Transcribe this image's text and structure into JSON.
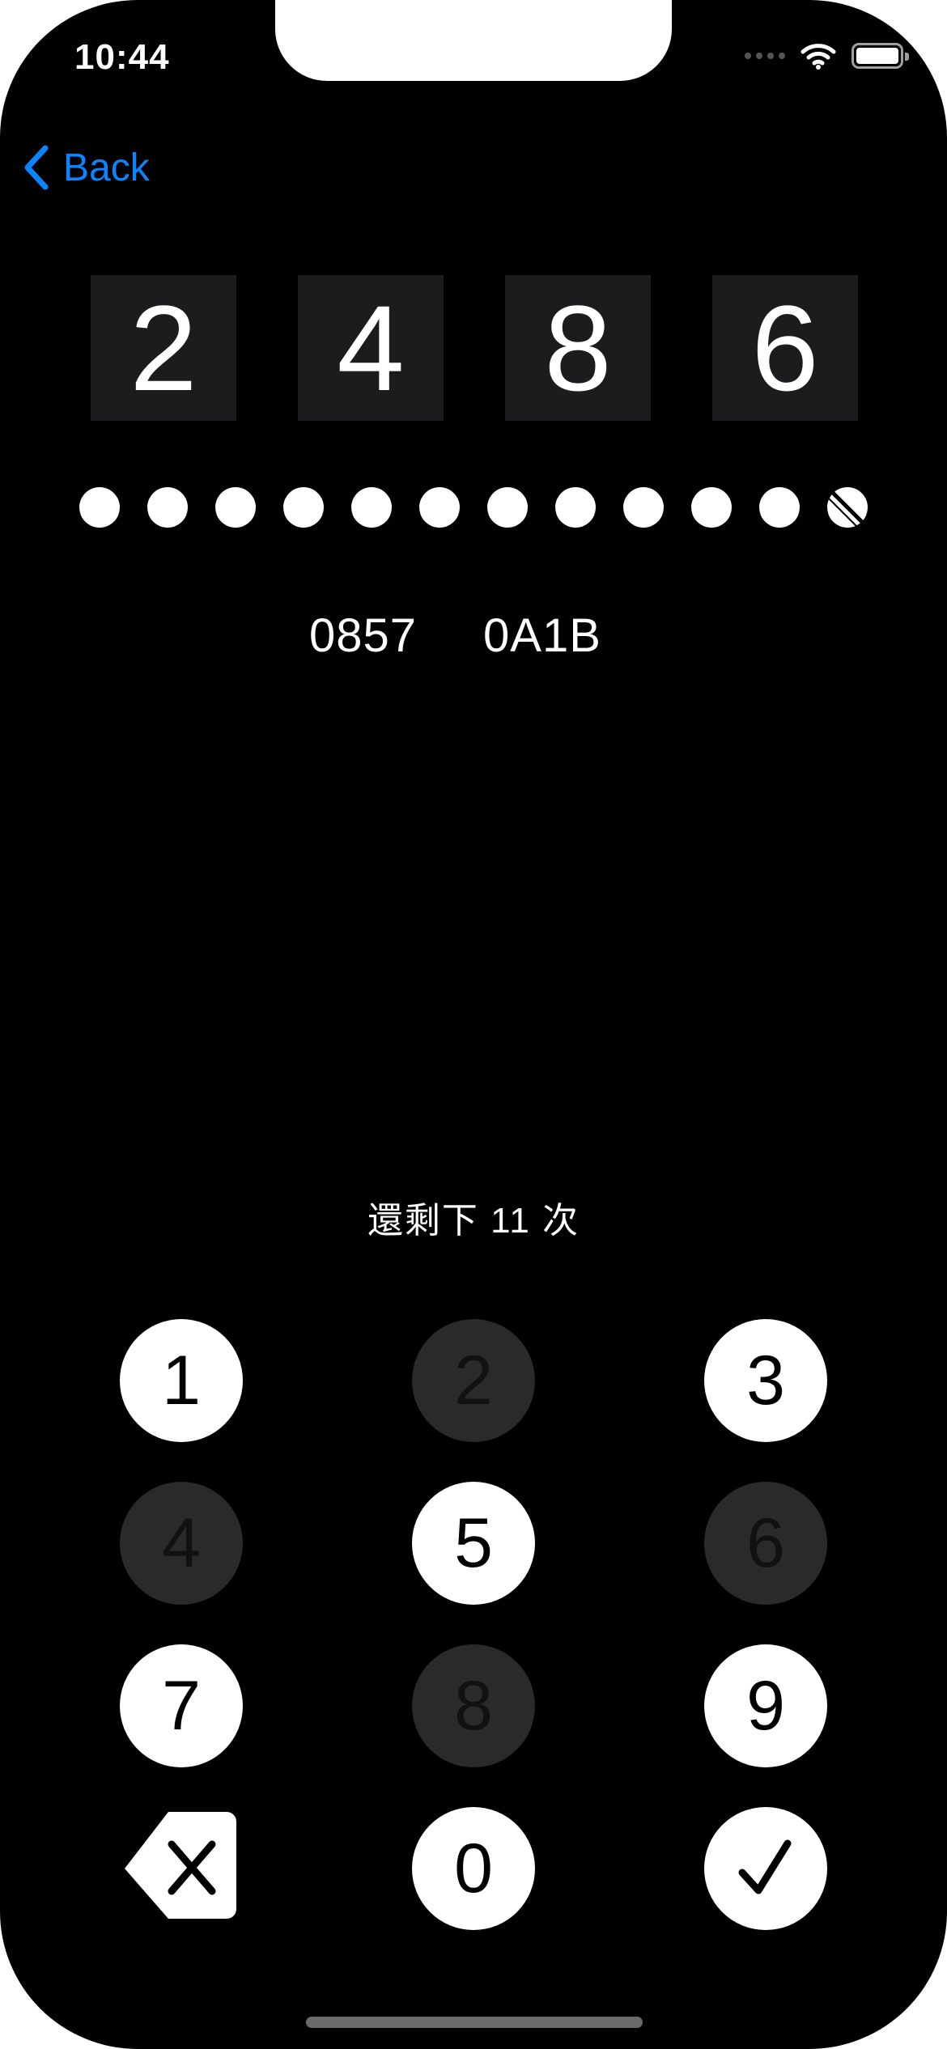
{
  "status_bar": {
    "time": "10:44",
    "icons": [
      "signal-dots-icon",
      "wifi-icon",
      "battery-icon"
    ]
  },
  "nav": {
    "back_label": "Back",
    "back_icon": "chevron-left-icon",
    "accent_color": "#0a84ff"
  },
  "guess_digits": [
    "2",
    "4",
    "8",
    "6"
  ],
  "attempts": {
    "total": 12,
    "remaining_dots": 11,
    "used_dots": 1
  },
  "hint": {
    "previous_guess": "0857",
    "result": "0A1B"
  },
  "remaining_text": "還剩下 11 次",
  "keypad": {
    "keys": [
      {
        "label": "1",
        "name": "key-1",
        "enabled": true
      },
      {
        "label": "2",
        "name": "key-2",
        "enabled": false
      },
      {
        "label": "3",
        "name": "key-3",
        "enabled": true
      },
      {
        "label": "4",
        "name": "key-4",
        "enabled": false
      },
      {
        "label": "5",
        "name": "key-5",
        "enabled": true
      },
      {
        "label": "6",
        "name": "key-6",
        "enabled": false
      },
      {
        "label": "7",
        "name": "key-7",
        "enabled": true
      },
      {
        "label": "8",
        "name": "key-8",
        "enabled": false
      },
      {
        "label": "9",
        "name": "key-9",
        "enabled": true
      }
    ],
    "zero_label": "0",
    "delete_icon": "delete-backspace-icon",
    "confirm_icon": "checkmark-icon"
  }
}
